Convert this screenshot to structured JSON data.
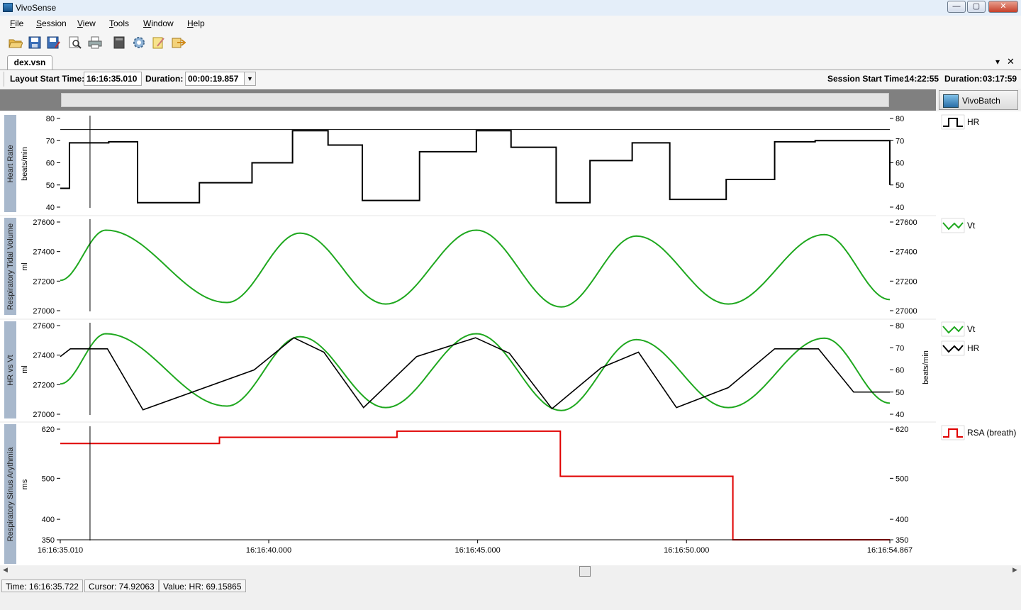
{
  "window": {
    "title": "VivoSense",
    "minimize": "—",
    "maximize": "▢",
    "close": "✕"
  },
  "menu": [
    "File",
    "Session",
    "View",
    "Tools",
    "Window",
    "Help"
  ],
  "toolbar": [
    "open-icon",
    "save-icon",
    "save-as-icon",
    "preview-icon",
    "print-icon",
    "export-icon",
    "settings-icon",
    "edit-icon",
    "import-icon"
  ],
  "tab": {
    "label": "dex.vsn",
    "dropdown": "▾",
    "close": "✕"
  },
  "info": {
    "layout_start_label": "Layout Start Time:",
    "layout_start_value": "16:16:35.010",
    "duration_label": "Duration:",
    "duration_value": "00:00:19.857",
    "session_start_label": "Session Start Time:",
    "session_start_value": "14:22:55",
    "session_duration_label": "Duration:",
    "session_duration_value": "03:17:59"
  },
  "vivobatch": {
    "label": "VivoBatch"
  },
  "panels": {
    "hr": {
      "title": "Heart Rate",
      "unit": "beats/min",
      "ticks": [
        "80",
        "70",
        "60",
        "50",
        "40"
      ],
      "legend": "HR"
    },
    "vt": {
      "title": "Respiratory Tidal Volume",
      "unit": "ml",
      "ticks": [
        "27600",
        "27400",
        "27200",
        "27000"
      ],
      "legend": "Vt"
    },
    "hrvt": {
      "title": "HR vs Vt",
      "unit_left": "ml",
      "unit_right": "beats/min",
      "ticks_left": [
        "27600",
        "27400",
        "27200",
        "27000"
      ],
      "ticks_right": [
        "80",
        "70",
        "60",
        "50",
        "40"
      ],
      "legend1": "Vt",
      "legend2": "HR"
    },
    "rsa": {
      "title": "Respiratory Sinus Arythmia",
      "unit": "ms",
      "ticks": [
        "620",
        "500",
        "400",
        "350"
      ],
      "legend": "RSA (breath)"
    }
  },
  "xaxis": {
    "ticks": [
      "16:16:35.010",
      "16:16:40.000",
      "16:16:45.000",
      "16:16:50.000",
      "16:16:54.867"
    ]
  },
  "status": {
    "time": "Time: 16:16:35.722",
    "cursor": "Cursor: 74.92063",
    "value": "Value: HR: 69.15865"
  },
  "chart_data": [
    {
      "type": "line",
      "title": "Heart Rate",
      "ylabel": "beats/min",
      "ylim": [
        40,
        80
      ],
      "step": true,
      "x_times": [
        "16:16:35.010",
        "16:16:35.23",
        "16:16:36.17",
        "16:16:36.86",
        "16:16:38.34",
        "16:16:39.6",
        "16:16:40.57",
        "16:16:41.42",
        "16:16:42.24",
        "16:16:43.61",
        "16:16:44.97",
        "16:16:45.8",
        "16:16:46.88",
        "16:16:47.69",
        "16:16:48.7",
        "16:16:49.6",
        "16:16:50.95",
        "16:16:52.11",
        "16:16:53.08",
        "16:16:54.867"
      ],
      "series": [
        {
          "name": "HR",
          "color": "#000000",
          "values": [
            48.5,
            69,
            69.5,
            42,
            51,
            60,
            74.5,
            68,
            43,
            65,
            74.5,
            67,
            42,
            61,
            69,
            43.5,
            52.5,
            69.5,
            70,
            50
          ]
        }
      ],
      "reference_line": 75
    },
    {
      "type": "line",
      "title": "Respiratory Tidal Volume",
      "ylabel": "ml",
      "ylim": [
        27000,
        27600
      ],
      "series": [
        {
          "name": "Vt",
          "color": "#1fa81f",
          "peaks": [
            {
              "t": "16:16:36.1",
              "v": 27545
            },
            {
              "t": "16:16:40.75",
              "v": 27525
            },
            {
              "t": "16:16:44.97",
              "v": 27545
            },
            {
              "t": "16:16:48.8",
              "v": 27505
            },
            {
              "t": "16:16:53.3",
              "v": 27515
            }
          ],
          "troughs": [
            {
              "t": "16:16:39.0",
              "v": 27055
            },
            {
              "t": "16:16:42.8",
              "v": 27045
            },
            {
              "t": "16:16:47.0",
              "v": 27025
            },
            {
              "t": "16:16:51.0",
              "v": 27045
            }
          ],
          "start": {
            "t": "16:16:35.010",
            "v": 27205
          },
          "end": {
            "t": "16:16:54.867",
            "v": 27075
          }
        }
      ]
    },
    {
      "type": "line",
      "title": "HR vs Vt",
      "ylabel": "ml",
      "ylabel_right": "beats/min",
      "series": [
        {
          "name": "Vt",
          "color": "#1fa81f",
          "axis": "left",
          "ylim": [
            27000,
            27600
          ]
        },
        {
          "name": "HR",
          "color": "#000000",
          "axis": "right",
          "ylim": [
            40,
            80
          ],
          "x_times": [
            "16:16:35.010",
            "16:16:35.25",
            "16:16:36.14",
            "16:16:36.99",
            "16:16:39.65",
            "16:16:40.6",
            "16:16:41.32",
            "16:16:42.27",
            "16:16:43.54",
            "16:16:44.95",
            "16:16:45.76",
            "16:16:46.78",
            "16:16:47.96",
            "16:16:48.85",
            "16:16:49.76",
            "16:16:51.0",
            "16:16:52.11",
            "16:16:53.16",
            "16:16:54.0",
            "16:16:54.867"
          ],
          "values": [
            66,
            69.5,
            69.5,
            42,
            60,
            74.5,
            68,
            43,
            66,
            74.5,
            67.5,
            42.5,
            61,
            68,
            43,
            52,
            69.5,
            69.5,
            50,
            50
          ]
        }
      ]
    },
    {
      "type": "line",
      "title": "Respiratory Sinus Arythmia",
      "ylabel": "ms",
      "ylim": [
        350,
        620
      ],
      "step": true,
      "x_times": [
        "16:16:35.010",
        "16:16:38.82",
        "16:16:43.07",
        "16:16:46.98",
        "16:16:51.11",
        "16:16:54.867"
      ],
      "series": [
        {
          "name": "RSA (breath)",
          "color": "#e00000",
          "values": [
            585,
            600,
            615,
            505,
            350,
            350
          ]
        }
      ]
    }
  ],
  "cursor_time": "16:16:35.722"
}
